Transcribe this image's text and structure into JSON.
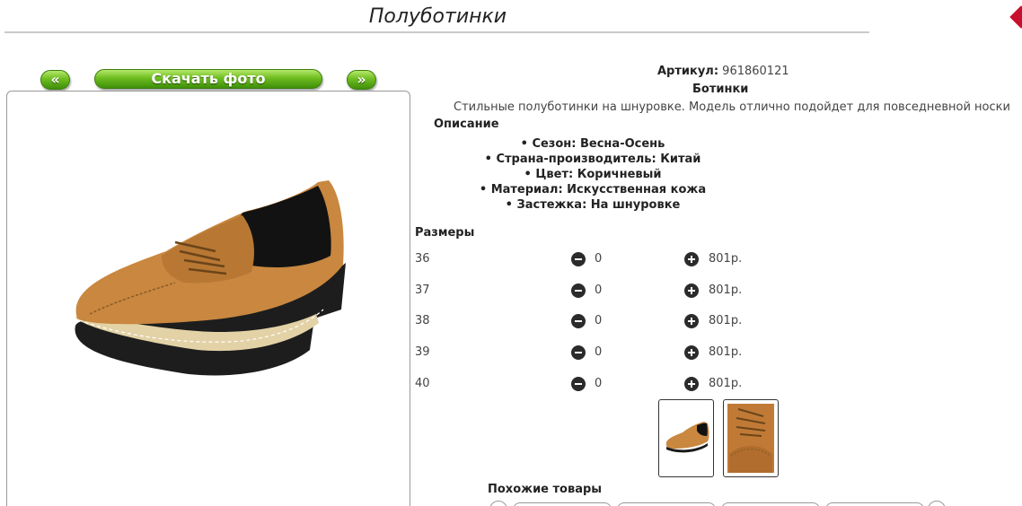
{
  "header": {
    "title": "Полуботинки"
  },
  "gallery": {
    "prev_label": "«",
    "download_label": "Скачать фото",
    "next_label": "»"
  },
  "product": {
    "sku_label": "Артикул:",
    "sku_value": "961860121",
    "category": "Ботинки",
    "description": "Стильные полуботинки на шнуровке. Модель отлично подойдет для повседневной носки",
    "description_heading": "Описание",
    "specs": [
      "Сезон: Весна-Осень",
      "Страна-производитель: Китай",
      "Цвет: Коричневый",
      "Материал: Искусственная кожа",
      "Застежка: На шнуровке"
    ]
  },
  "sizes": {
    "heading": "Размеры",
    "rows": [
      {
        "size": "36",
        "qty": "0",
        "price": "801р."
      },
      {
        "size": "37",
        "qty": "0",
        "price": "801р."
      },
      {
        "size": "38",
        "qty": "0",
        "price": "801р."
      },
      {
        "size": "39",
        "qty": "0",
        "price": "801р."
      },
      {
        "size": "40",
        "qty": "0",
        "price": "801р."
      }
    ]
  },
  "similar": {
    "heading": "Похожие товары"
  },
  "colors": {
    "shoe": "#c9873f",
    "sole": "#1a1a1a",
    "button_green": "#6ebd20"
  },
  "icons": [
    "minus-icon",
    "plus-icon",
    "shoe-photo",
    "shoe-closeup-photo"
  ]
}
